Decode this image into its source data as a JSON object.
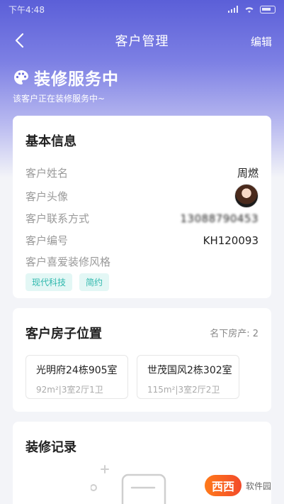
{
  "statusbar": {
    "time": "下午4:48"
  },
  "navbar": {
    "title": "客户管理",
    "edit_label": "编辑"
  },
  "hero": {
    "title": "装修服务中",
    "subtitle": "该客户正在装修服务中~"
  },
  "basic_info": {
    "title": "基本信息",
    "rows": [
      {
        "label": "客户姓名",
        "value": "周燃"
      },
      {
        "label": "客户头像",
        "value": ""
      },
      {
        "label": "客户联系方式",
        "value": "13088790453"
      },
      {
        "label": "客户编号",
        "value": "KH120093"
      },
      {
        "label": "客户喜爱装修风格",
        "value": ""
      }
    ],
    "tags": [
      "现代科技",
      "简约"
    ]
  },
  "houses": {
    "title": "客户房子位置",
    "count_label": "名下房产: 2",
    "items": [
      {
        "name": "光明府24栋905室",
        "detail": "92m²|3室2厅1卫"
      },
      {
        "name": "世茂国风2栋302室",
        "detail": "115m²|3室2厅2卫"
      }
    ]
  },
  "records": {
    "title": "装修记录"
  },
  "watermark": {
    "badge": "西西",
    "text": "软件园"
  },
  "colors": {
    "accent": "#5b5fd8",
    "tag": "#2fb8ad"
  }
}
